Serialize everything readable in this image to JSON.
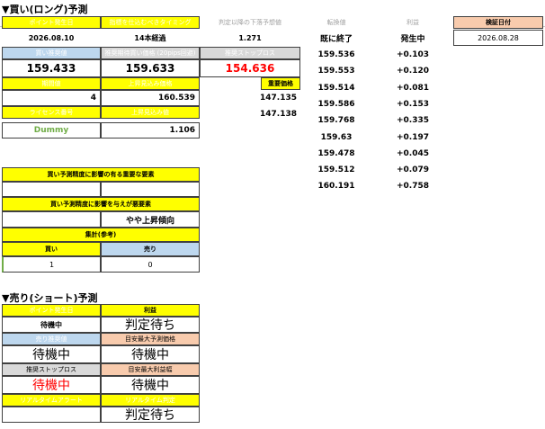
{
  "title_long": "▼買い(ロング)予測",
  "title_short": "▼売り(ショート)予測",
  "long": {
    "labels": {
      "point_date": "ポイント発生日",
      "timing": "指標を仕込むべきタイミング",
      "prev_low": "判定以降の下落予想値",
      "result_price": "転換値",
      "profit": "利益",
      "settle_date": "検証日付",
      "buy_entry": "買い推奨値",
      "recommended_buy": "推奨期待買い価格 (20pips回避)",
      "stop_loss": "推奨ストップロス",
      "period": "期間値",
      "upper_reached": "上昇見込み価格",
      "important_price": "重要価格",
      "license_no": "ライセンス番号",
      "upper_estimate": "上昇見込み値"
    },
    "values": {
      "point_date": "2026.08.10",
      "timing": "14本経過",
      "prev_low": "1.271",
      "status": "既に終了",
      "occurrence": "発生中",
      "settle_date": "2026.08.28",
      "buy_entry": "159.433",
      "recommended_buy": "159.633",
      "stop_loss": "154.636",
      "period": "4",
      "upper_reached": "160.539",
      "important_1": "147.135",
      "important_2": "147.138",
      "license": "Dummy",
      "upper_estimate": "1.106"
    },
    "price_list": [
      "159.536",
      "159.553",
      "159.514",
      "159.586",
      "159.768",
      "159.63",
      "159.478",
      "159.512",
      "160.191"
    ],
    "profit_list": [
      "+0.103",
      "+0.120",
      "+0.081",
      "+0.153",
      "+0.335",
      "+0.197",
      "+0.045",
      "+0.079",
      "+0.758"
    ],
    "lower": {
      "buy_influence": "買い予測精度に影響の有る重要な要素",
      "sell_influence": "買い予測精度に影響を与えが悪要素",
      "trend": "やや上昇傾向",
      "count_header": "集計(参考)",
      "buy_label": "買い",
      "sell_label": "売り",
      "buy_count": "1",
      "sell_count": "0"
    }
  },
  "short": {
    "labels": {
      "point_date": "ポイント発生日",
      "profit": "利益",
      "sell_entry": "売り推奨値",
      "target_upper": "目安最大予測価格",
      "stop_loss": "推奨ストップロス",
      "target_profit": "目安最大利益幅",
      "realtime_alert": "リアルタイムアラート",
      "realtime_judgement": "リアルタイム判定"
    },
    "values": {
      "point_date": "待機中",
      "profit": "判定待ち",
      "sell_entry": "待機中",
      "target_upper": "待機中",
      "stop_loss": "待機中",
      "target_profit": "待機中",
      "realtime_alert": "",
      "realtime_judgement": "判定待ち"
    }
  }
}
